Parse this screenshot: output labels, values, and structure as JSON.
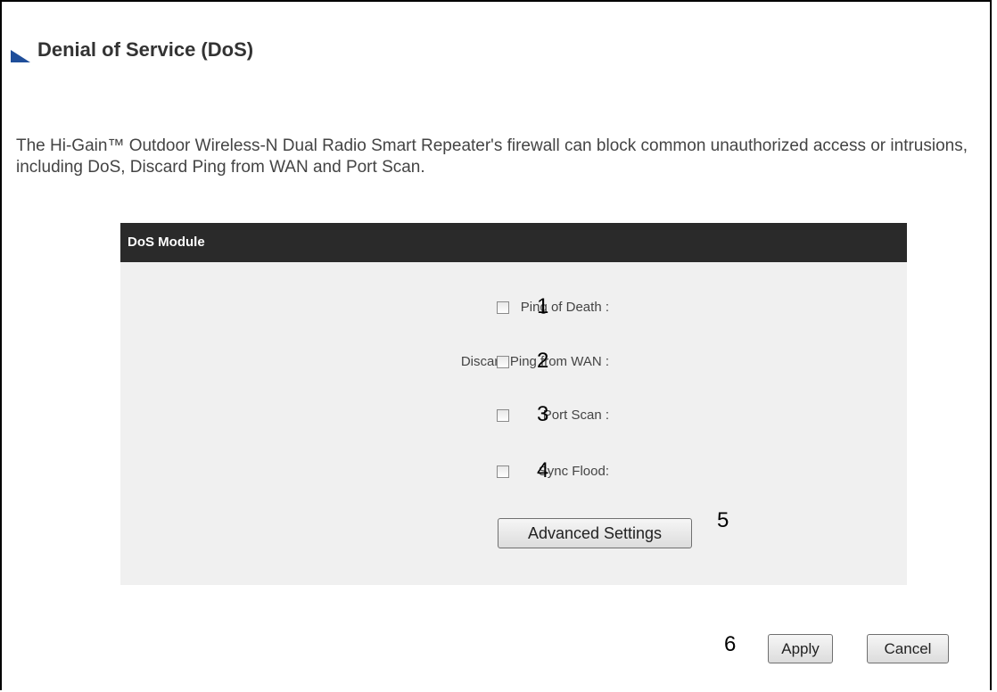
{
  "page": {
    "title": "Denial of Service (DoS)",
    "description": "The Hi-Gain™ Outdoor Wireless-N Dual Radio Smart Repeater's firewall can block common unauthorized access or intrusions, including DoS, Discard Ping from WAN and Port Scan."
  },
  "panel": {
    "header": "DoS Module",
    "rows": [
      {
        "label": "Ping of Death :",
        "checked": false,
        "marker": "1"
      },
      {
        "label": "Discard Ping from WAN :",
        "checked": false,
        "marker": "2"
      },
      {
        "label": "Port Scan :",
        "checked": false,
        "marker": "3"
      },
      {
        "label": "Sync Flood:",
        "checked": false,
        "marker": "4"
      }
    ],
    "advanced_button": "Advanced Settings",
    "advanced_marker": "5"
  },
  "footer": {
    "marker": "6",
    "apply_label": "Apply",
    "cancel_label": "Cancel"
  },
  "colors": {
    "panel_header_bg": "#2a2a2a",
    "panel_bg": "#f0f0f0",
    "title_icon": "#1f4e9a"
  },
  "icons": {
    "title": "triangle-marker-icon"
  }
}
